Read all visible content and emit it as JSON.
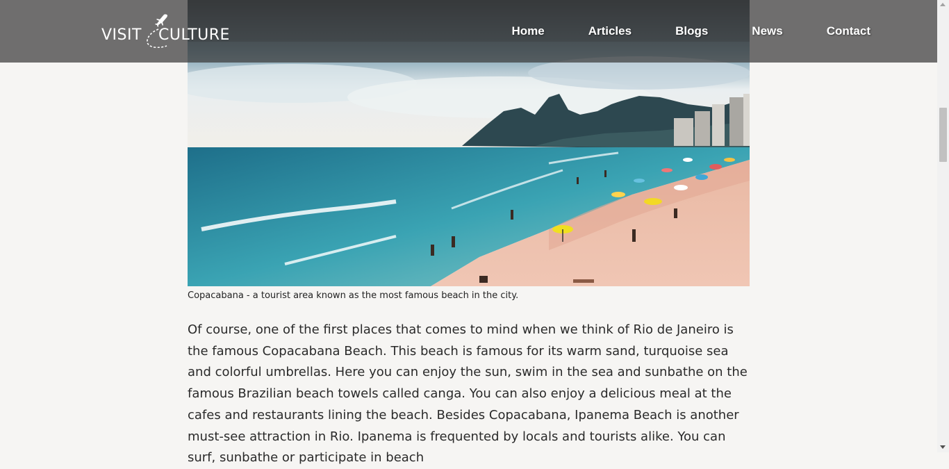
{
  "header": {
    "logo_left": "VISIT",
    "logo_right": "CULTURE",
    "nav": [
      "Home",
      "Articles",
      "Blogs",
      "News",
      "Contact"
    ]
  },
  "hero": {
    "caption": "Copacabana - a tourist area known as the most famous beach in the city."
  },
  "article": {
    "paragraph": "Of course, one of the first places that comes to mind when we think of Rio de Janeiro is the famous Copacabana Beach. This beach is famous for its warm sand, turquoise sea and colorful umbrellas. Here you can enjoy the sun, swim in the sea and sunbathe on the famous Brazilian beach towels called canga. You can also enjoy a delicious meal at the cafes and restaurants lining the beach. Besides Copacabana, Ipanema Beach is another must-see attraction in Rio. Ipanema is frequented by locals and tourists alike. You can surf, sunbathe or participate in beach"
  },
  "colors": {
    "header_bg": "#3a3a3a",
    "page_bg": "#f6f5f3",
    "text": "#2a2a2a"
  }
}
